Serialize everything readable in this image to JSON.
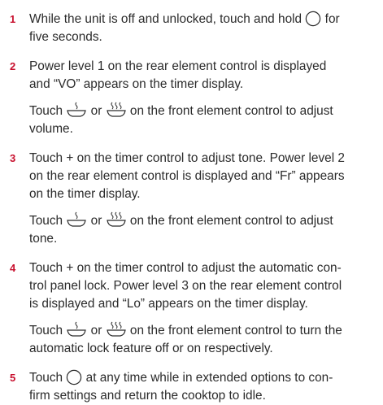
{
  "steps": [
    {
      "number": "1",
      "parts": [
        "While the unit is off and unlocked, touch and hold ",
        " for",
        "five seconds."
      ]
    },
    {
      "number": "2",
      "line1": "Power level 1 on the rear element control is displayed",
      "line2": "and “VO” appears on the timer display.",
      "sub": [
        "Touch ",
        " or ",
        " on the front element control to adjust",
        "volume."
      ]
    },
    {
      "number": "3",
      "line1": "Touch + on the timer control to adjust tone. Power level 2",
      "line2": "on the rear element control is displayed and “Fr” appears",
      "line3": "on the timer display.",
      "sub": [
        "Touch ",
        " or ",
        " on the front element control to adjust",
        "tone."
      ]
    },
    {
      "number": "4",
      "line1": "Touch + on the timer control to adjust the automatic con-",
      "line2": "trol panel lock. Power level 3 on the rear element control",
      "line3": "is displayed and “Lo” appears on the timer display.",
      "sub": [
        "Touch ",
        " or ",
        " on the front element control to turn the",
        "automatic lock feature off or on respectively."
      ]
    },
    {
      "number": "5",
      "parts": [
        "Touch ",
        " at any time while in extended options to con-",
        "firm settings and return the cooktop to idle."
      ]
    }
  ],
  "icons": {
    "power": "power-circle-icon",
    "low": "low-heat-pot-icon",
    "high": "high-heat-pot-icon"
  },
  "colors": {
    "number": "#c8102e",
    "text": "#2b2b2b"
  }
}
